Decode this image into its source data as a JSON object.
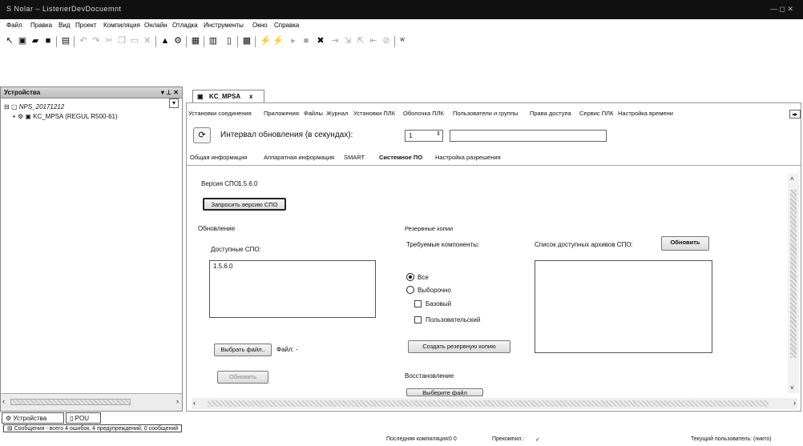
{
  "title": "S  Nolar – ListenerDevDocuemnt",
  "window_controls": "— ◻ ✕",
  "menu": [
    "Файл",
    "Правка",
    "Вид",
    "Проект",
    "Компиляция",
    "Онлайн",
    "Отладка",
    "Инструменты",
    "Окно",
    "Справка"
  ],
  "left_panel": {
    "title": "Устройства",
    "pin": "▾ ⊥ ✕",
    "tree": [
      {
        "label": "NPS_20171212",
        "icon": "project-icon"
      },
      {
        "label": "KC_MPSA (REGUL R500-61)",
        "icon": "plc-device-icon"
      }
    ]
  },
  "bottom_tabs": [
    "Устройства",
    "POU"
  ],
  "messages": "Сообщения - всего 4 ошибок, 4 предупреждений, 0 сообщений",
  "status": {
    "last_compile": "Последняя компиляция:",
    "compile_counts": "0  0",
    "precompile": "Прекомпил.:",
    "current_user": "Текущий пользователь: (никто)"
  },
  "doc_tab": {
    "label": "KC_MPSA",
    "close": "x"
  },
  "sub_tabs": [
    "Установки соединения",
    "Приложения",
    "Файлы",
    "Журнал",
    "Установки ПЛК",
    "Оболочка ПЛК",
    "Пользователи и группы",
    "Права доступа",
    "Сервис ПЛК",
    "Настройка времени"
  ],
  "refresh": {
    "label": "Интервал обновления (в секундах):",
    "value": "1"
  },
  "inner_tabs": [
    "Общая информация",
    "Аппаратная информация",
    "SMART",
    "Системное ПО",
    "Настройка разрешения"
  ],
  "spo": {
    "version_label": "Версия СПО:",
    "version_value": "1.5.6.0",
    "request_button": "Запросить версию СПО"
  },
  "update": {
    "section": "Обновление",
    "available_label": "Доступные СПО:",
    "available_items": [
      "1.5.6.0"
    ],
    "choose_file_button": "Выбрать файл..",
    "file_label": "Файл:",
    "file_value": "-",
    "update_button": "Обновить"
  },
  "backup": {
    "section": "Резервные копии",
    "components_label": "Требуемые компоненты:",
    "radio_all": "Все",
    "radio_selective": "Выборочно",
    "check_basic": "Базовый",
    "check_user": "Пользовательский",
    "create_button": "Создать резервную копию",
    "archives_label": "Список доступных архивов СПО:",
    "refresh_button": "Обновить"
  },
  "restore": {
    "section": "Восстановление",
    "choose_button": "Выберите файл"
  }
}
